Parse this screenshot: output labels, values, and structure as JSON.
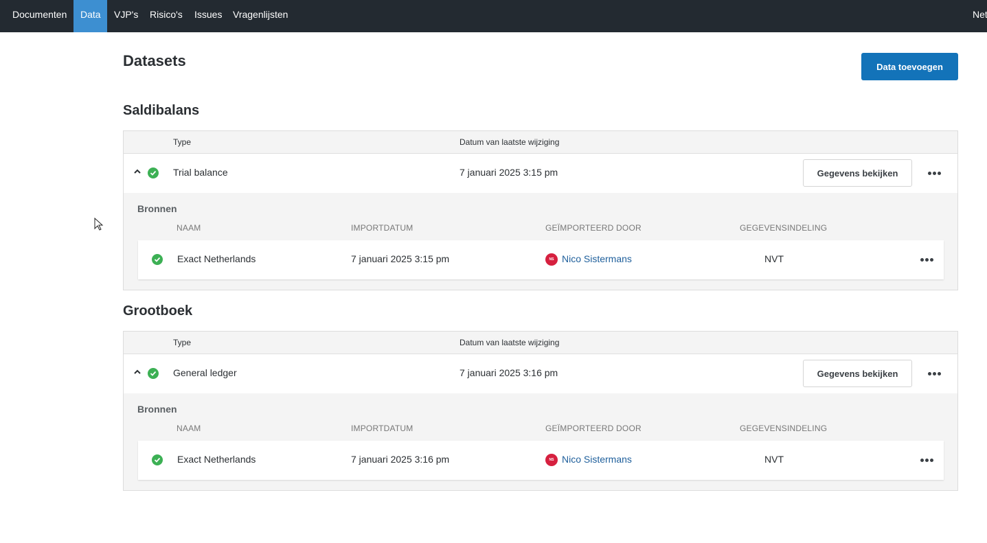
{
  "nav": {
    "items": [
      {
        "label": "Documenten",
        "active": false
      },
      {
        "label": "Data",
        "active": true
      },
      {
        "label": "VJP's",
        "active": false
      },
      {
        "label": "Risico's",
        "active": false
      },
      {
        "label": "Issues",
        "active": false
      },
      {
        "label": "Vragenlijsten",
        "active": false
      }
    ],
    "right_label": "Net"
  },
  "page": {
    "title": "Datasets",
    "add_button": "Data toevoegen"
  },
  "colors": {
    "nav_bg": "#232a31",
    "nav_active": "#3d8fd1",
    "primary": "#1373b9",
    "success": "#3cb054",
    "avatar": "#d6203f",
    "link": "#20609c"
  },
  "sections": [
    {
      "title": "Saldibalans",
      "header": {
        "type": "Type",
        "date": "Datum van laatste wijziging"
      },
      "row": {
        "type": "Trial balance",
        "date": "7 januari 2025 3:15 pm",
        "view_button": "Gegevens bekijken",
        "status_icon": "check-circle-icon"
      },
      "sources": {
        "label": "Bronnen",
        "columns": [
          "NAAM",
          "IMPORTDATUM",
          "GEÏMPORTEERD DOOR",
          "GEGEVENSINDELING"
        ],
        "rows": [
          {
            "name": "Exact Netherlands",
            "import_date": "7 januari 2025 3:15 pm",
            "avatar_initials": "NS",
            "imported_by": "Nico Sistermans",
            "format": "NVT"
          }
        ]
      }
    },
    {
      "title": "Grootboek",
      "header": {
        "type": "Type",
        "date": "Datum van laatste wijziging"
      },
      "row": {
        "type": "General ledger",
        "date": "7 januari 2025 3:16 pm",
        "view_button": "Gegevens bekijken",
        "status_icon": "check-circle-icon"
      },
      "sources": {
        "label": "Bronnen",
        "columns": [
          "NAAM",
          "IMPORTDATUM",
          "GEÏMPORTEERD DOOR",
          "GEGEVENSINDELING"
        ],
        "rows": [
          {
            "name": "Exact Netherlands",
            "import_date": "7 januari 2025 3:16 pm",
            "avatar_initials": "NS",
            "imported_by": "Nico Sistermans",
            "format": "NVT"
          }
        ]
      }
    }
  ]
}
